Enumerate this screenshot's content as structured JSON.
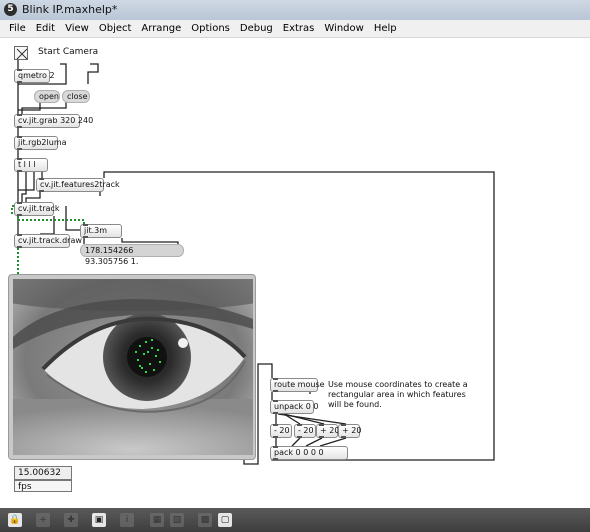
{
  "window": {
    "title": "Blink IP.maxhelp*",
    "icon_label": "5"
  },
  "menu": [
    "File",
    "Edit",
    "View",
    "Object",
    "Arrange",
    "Options",
    "Debug",
    "Extras",
    "Window",
    "Help"
  ],
  "patcher": {
    "toggle_comment": "Start Camera",
    "objects": {
      "qmetro": "qmetro 2",
      "grab": "cv.jit.grab 320 240",
      "rgb2luma": "jit.rgb2luma",
      "trigger": "t l l l",
      "features2track": "cv.jit.features2track",
      "track": "cv.jit.track",
      "trackdraw": "cv.jit.track.draw",
      "jit3m": "jit.3m",
      "route": "route mouse",
      "unpack": "unpack 0 0",
      "minus_a": "- 20",
      "minus_b": "- 20",
      "plus_a": "+ 20",
      "plus_b": "+ 20",
      "pack": "pack 0 0 0 0"
    },
    "messages": {
      "open": "open",
      "close": "close"
    },
    "stats_message": "178.154266 93.305756 1.",
    "mouse_comment": "Use mouse coordinates to create a rectangular area in which features will be found.",
    "fps_value": "15.00632",
    "fps_label": "fps"
  },
  "toolbar": [
    "lock-icon",
    "new-object-icon",
    "grid-icon",
    "presentation-icon",
    "info-icon",
    "windows-icon",
    "palette-icon",
    "snap-icon",
    "zoom-icon"
  ]
}
